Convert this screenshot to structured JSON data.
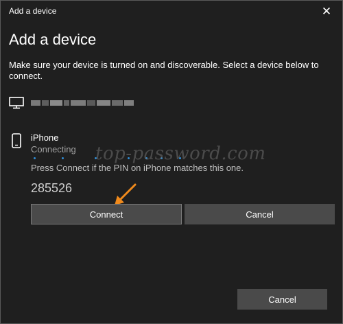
{
  "window": {
    "title": "Add a device",
    "close_glyph": "✕"
  },
  "heading": "Add a device",
  "description": "Make sure your device is turned on and discoverable. Select a device below to connect.",
  "devices": [
    {
      "type": "monitor-icon",
      "name_blurred": true
    },
    {
      "type": "phone-icon",
      "name": "iPhone",
      "status": "Connecting"
    }
  ],
  "pin_prompt": "Press Connect if the PIN on iPhone matches this one.",
  "pin_code": "285526",
  "buttons": {
    "connect": "Connect",
    "cancel_inline": "Cancel",
    "cancel_footer": "Cancel"
  },
  "watermark": "top-password.com",
  "colors": {
    "background": "#1f1f1f",
    "button": "#4a4a4a",
    "accent_dots": "#2f8dd6",
    "arrow": "#f08a1c"
  }
}
